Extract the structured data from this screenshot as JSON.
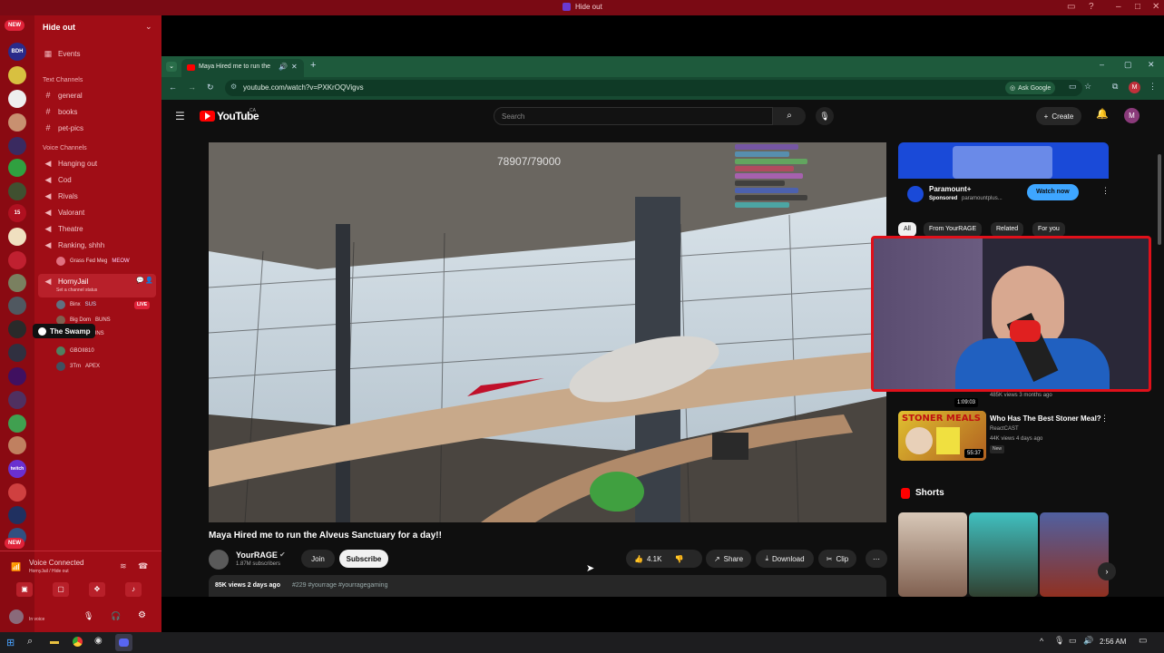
{
  "window": {
    "title": "Hide out"
  },
  "rail": {
    "new_badge_top": "NEW",
    "new_badge_bottom": "NEW",
    "server_15": "15",
    "server_twitch": "twitch"
  },
  "channels": {
    "server_name": "Hide out",
    "events": "Events",
    "text_header": "Text Channels",
    "text": [
      "general",
      "books",
      "pet-pics"
    ],
    "voice_header": "Voice Channels",
    "voice": [
      "Hanging out",
      "Cod",
      "Rivals",
      "Valorant",
      "Theatre",
      "Ranking, shhh"
    ],
    "ranking_user": "Grass Fed Meg",
    "ranking_tag": "MEOW",
    "hornyjail": "HornyJail",
    "hornyjail_status": "Set a channel status",
    "live": "LIVE",
    "users": [
      {
        "name": "Binx",
        "tag": "SUS"
      },
      {
        "name": "Big Dom",
        "tag": "BUNS"
      },
      {
        "name": "",
        "tag": "BUNS"
      },
      {
        "name": "GBOII810",
        "tag": ""
      },
      {
        "name": "3Tm",
        "tag": "APEX"
      }
    ],
    "tooltip": "The Swamp"
  },
  "voice_panel": {
    "connected": "Voice Connected",
    "location": "HornyJail / Hide out",
    "user_status": "In voice"
  },
  "browser": {
    "tab_title": "Maya Hired me to run the",
    "url": "youtube.com/watch?v=PXKrOQVigvs",
    "ask_google": "Ask Google",
    "profile": "M"
  },
  "youtube": {
    "logo": "YouTube",
    "country": "CA",
    "search_placeholder": "Search",
    "create": "Create",
    "avatar": "M",
    "video_title": "Maya Hired me to run the Alveus Sanctuary for a day!!",
    "overlay_counter": "78907/79000",
    "channel_name": "YourRAGE",
    "subscribers": "1.87M subscribers",
    "join": "Join",
    "subscribe": "Subscribe",
    "likes": "4.1K",
    "share": "Share",
    "download": "Download",
    "clip": "Clip",
    "views_line": "85K views  2 days ago",
    "tags": "#229 #yourrage #yourragegaming",
    "ad_title": "Paramount+",
    "ad_sponsor": "Sponsored",
    "ad_domain": "paramountplus...",
    "ad_button": "Watch now",
    "chips": [
      "All",
      "From YourRAGE",
      "Related",
      "For you"
    ],
    "rec1_duration": "1:09:03",
    "rec1_meta": "485K views  3 months ago",
    "rec2_title": "Who Has The Best Stoner Meal?",
    "rec2_channel": "ReactCAST",
    "rec2_meta": "44K views  4 days ago",
    "rec2_badge": "New",
    "rec2_duration": "55:37",
    "rec2_thumb_text": "STONER MEALS",
    "shorts": "Shorts"
  },
  "taskbar": {
    "time": "2:56 AM"
  },
  "colors": {
    "discord_red": "#a00d16",
    "yt_red": "#ff0000",
    "browser_green": "#1e5a3c"
  }
}
